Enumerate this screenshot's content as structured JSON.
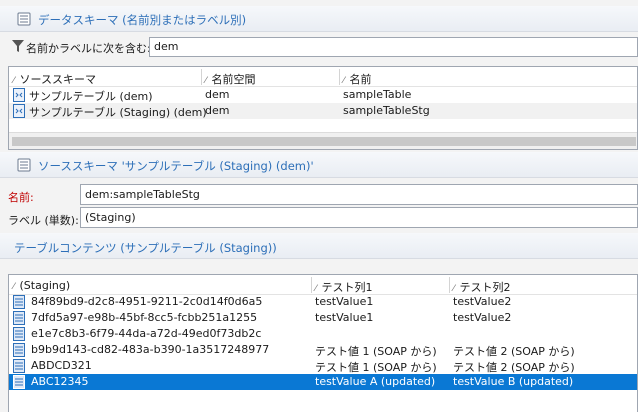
{
  "data_schema": {
    "title": "データスキーマ (名前別またはラベル別)",
    "filter_label": "名前かラベルに次を含む:",
    "filter_value": "dem"
  },
  "source_grid": {
    "columns": [
      "ソーススキーマ",
      "名前空間",
      "名前"
    ],
    "rows": [
      {
        "label": "サンプルテーブル (dem)",
        "namespace": "dem",
        "name": "sampleTable"
      },
      {
        "label": "サンプルテーブル (Staging) (dem)",
        "namespace": "dem",
        "name": "sampleTableStg"
      }
    ]
  },
  "source_schema": {
    "title": "ソーススキーマ 'サンプルテーブル (Staging) (dem)'",
    "name_label": "名前:",
    "name_value": "dem:sampleTableStg",
    "label_label": "ラベル (単数):",
    "label_value": "(Staging)"
  },
  "table_content": {
    "title": "テーブルコンテンツ (サンプルテーブル (Staging))",
    "columns": [
      "(Staging)",
      "テスト列1",
      "テスト列2"
    ],
    "rows": [
      {
        "id": "84f89bd9-d2c8-4951-9211-2c0d14f0d6a5",
        "col1": "testValue1",
        "col2": "testValue2"
      },
      {
        "id": "7dfd5a97-e98b-45bf-8cc5-fcbb251a1255",
        "col1": "testValue1",
        "col2": "testValue2"
      },
      {
        "id": "e1e7c8b3-6f79-44da-a72d-49ed0f73db2c",
        "col1": "",
        "col2": ""
      },
      {
        "id": "b9b9d143-cd82-483a-b390-1a3517248977",
        "col1": "テスト値 1 (SOAP から)",
        "col2": "テスト値 2 (SOAP から)"
      },
      {
        "id": "ABDCD321",
        "col1": "テスト値 1 (SOAP から)",
        "col2": "テスト値 2 (SOAP から)"
      },
      {
        "id": "ABC12345",
        "col1": "testValue A (updated)",
        "col2": "testValue B (updated)"
      }
    ],
    "selected_row": 5
  },
  "colors": {
    "accent": "#2d6fb8",
    "selection": "#0a78d4",
    "required": "#c00000"
  },
  "icons": [
    "schema-icon",
    "filter-icon",
    "table-row-icon",
    "record-icon"
  ]
}
